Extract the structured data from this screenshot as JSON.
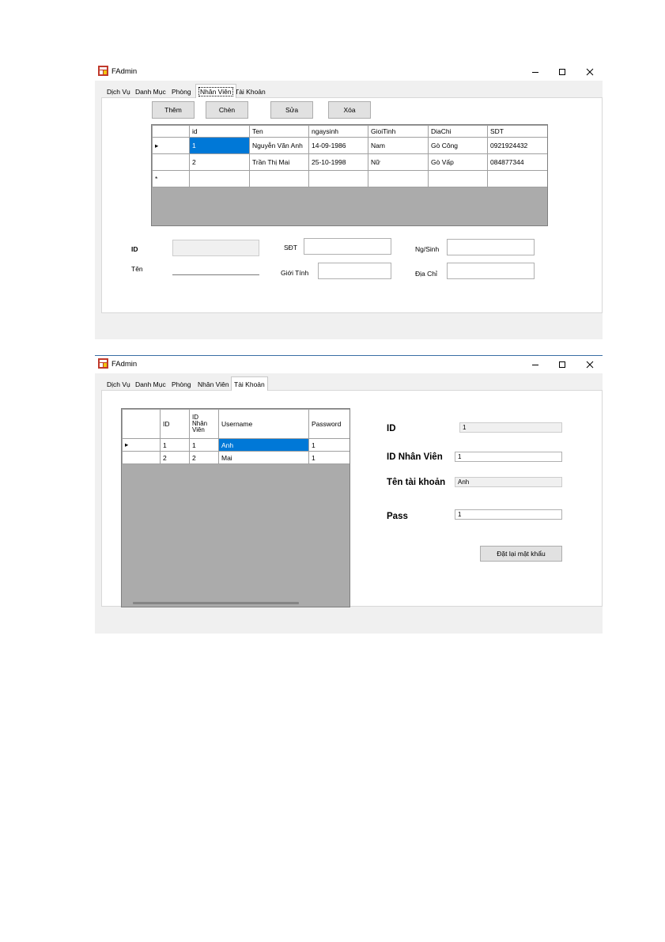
{
  "window_title": "FAdmin",
  "tabs": [
    "Dịch Vụ",
    "Danh Mục",
    "Phòng",
    "Nhân Viên",
    "Tài Khoản"
  ],
  "nhanvien": {
    "buttons": {
      "add": "Thêm",
      "insert": "Chèn",
      "edit": "Sửa",
      "delete": "Xóa"
    },
    "columns": [
      "id",
      "Ten",
      "ngaysinh",
      "GioiTinh",
      "DiaChi",
      "SDT"
    ],
    "rows": [
      {
        "marker": "▸",
        "id": "1",
        "ten": "Nguyễn Văn Anh",
        "ngaysinh": "14-09-1986",
        "gioitinh": "Nam",
        "diachi": "Gò Công",
        "sdt": "0921924432"
      },
      {
        "marker": "",
        "id": "2",
        "ten": "Trần Thị Mai",
        "ngaysinh": "25-10-1998",
        "gioitinh": "Nữ",
        "diachi": "Gò Vấp",
        "sdt": "084877344"
      }
    ],
    "new_row_marker": "*",
    "form": {
      "id_label": "ID",
      "id_value": "",
      "ten_label": "Tên",
      "ten_value": "",
      "sdt_label": "SĐT",
      "sdt_value": "",
      "gioitinh_label": "Giới Tính",
      "gioitinh_value": "",
      "ngsinh_label": "Ng/Sinh",
      "ngsinh_value": "",
      "diachi_label": "Địa Chỉ",
      "diachi_value": ""
    }
  },
  "taikhoan": {
    "columns": [
      "ID",
      "ID\nNhân\nViên",
      "Username",
      "Password"
    ],
    "rows": [
      {
        "marker": "▸",
        "id": "1",
        "id_nhanvien": "1",
        "username": "Anh",
        "password": "1"
      },
      {
        "marker": "",
        "id": "2",
        "id_nhanvien": "2",
        "username": "Mai",
        "password": "1"
      }
    ],
    "form": {
      "id_label": "ID",
      "id_value": "1",
      "idnv_label": "ID Nhân Viên",
      "idnv_value": "1",
      "tentk_label": "Tên tài khoản",
      "tentk_value": "Anh",
      "pass_label": "Pass",
      "pass_value": "1",
      "reset_button": "Đặt lại mật khẩu"
    }
  },
  "colors": {
    "selection": "#0078d7",
    "grid_background": "#ababab",
    "window_body": "#f0f0f0"
  }
}
